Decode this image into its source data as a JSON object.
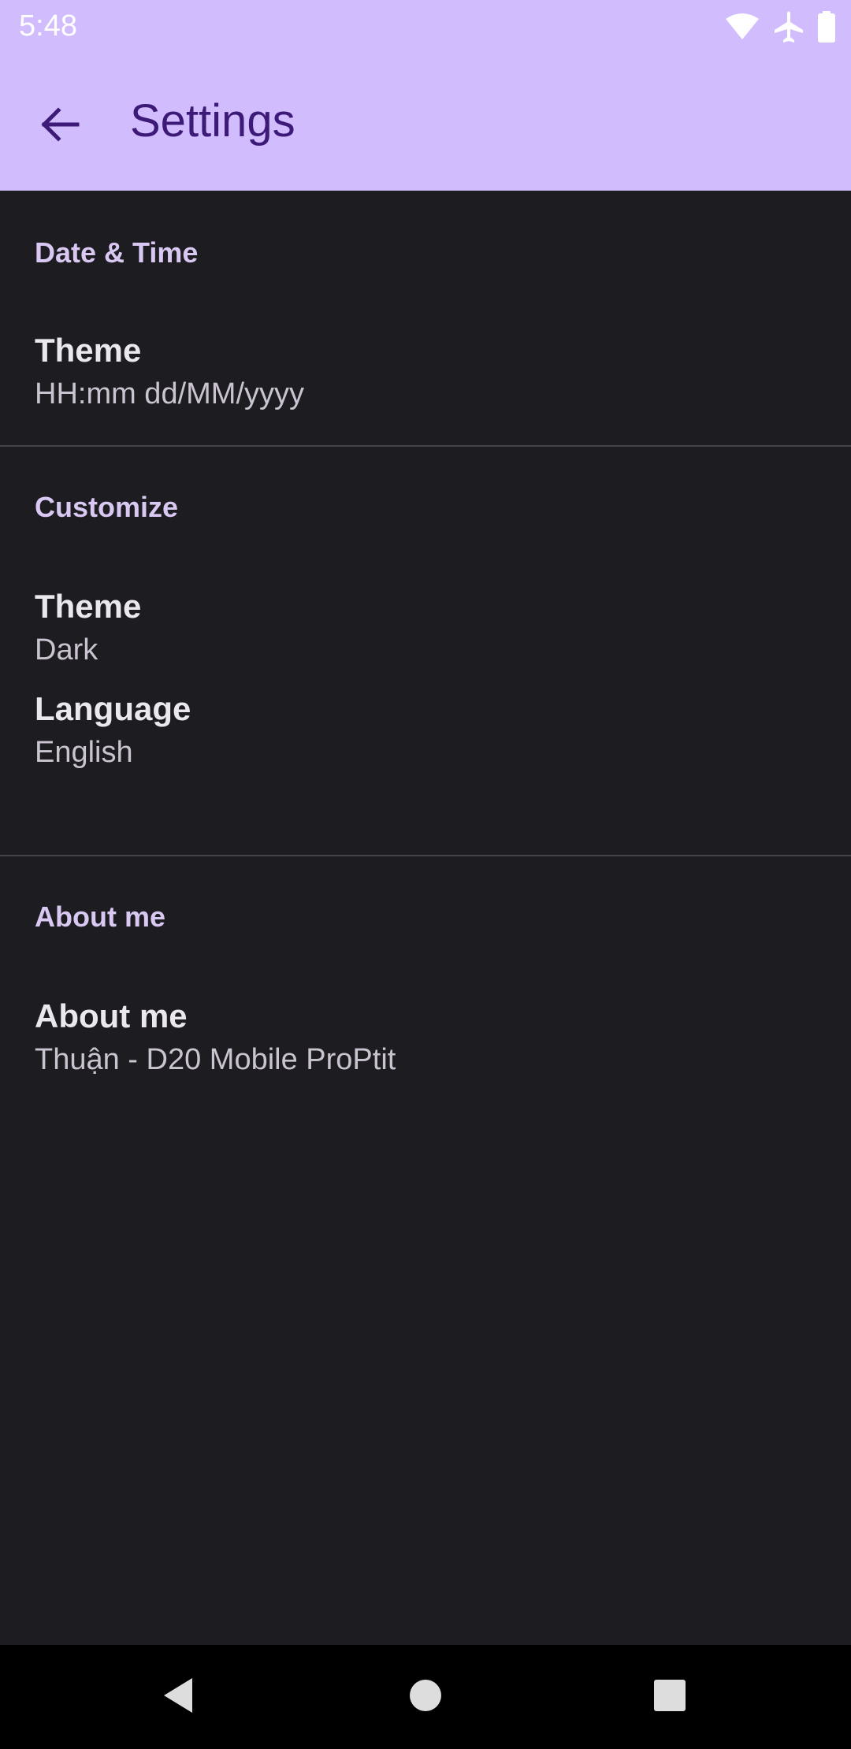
{
  "status_bar": {
    "time": "5:48",
    "icons": [
      "wifi-icon",
      "airplane-icon",
      "battery-icon"
    ]
  },
  "app_bar": {
    "title": "Settings",
    "back_icon": "arrow-back-icon"
  },
  "sections": {
    "date_time": {
      "header": "Date & Time",
      "items": [
        {
          "title": "Theme",
          "summary": "HH:mm dd/MM/yyyy"
        }
      ]
    },
    "customize": {
      "header": "Customize",
      "items": [
        {
          "title": "Theme",
          "summary": "Dark"
        },
        {
          "title": "Language",
          "summary": "English"
        }
      ]
    },
    "about": {
      "header": "About me",
      "items": [
        {
          "title": "About me",
          "summary": "Thuận - D20 Mobile ProPtit"
        }
      ]
    }
  },
  "nav_bar": {
    "icons": [
      "back-triangle-icon",
      "home-circle-icon",
      "recents-square-icon"
    ]
  },
  "colors": {
    "app_bar_bg": "#d1bcfd",
    "title_color": "#3d1a78",
    "background": "#1d1c21",
    "section_header": "#d9c8f2",
    "item_title": "#ebe7ef",
    "item_summary": "#c9c4cf",
    "divider": "#45434a"
  }
}
